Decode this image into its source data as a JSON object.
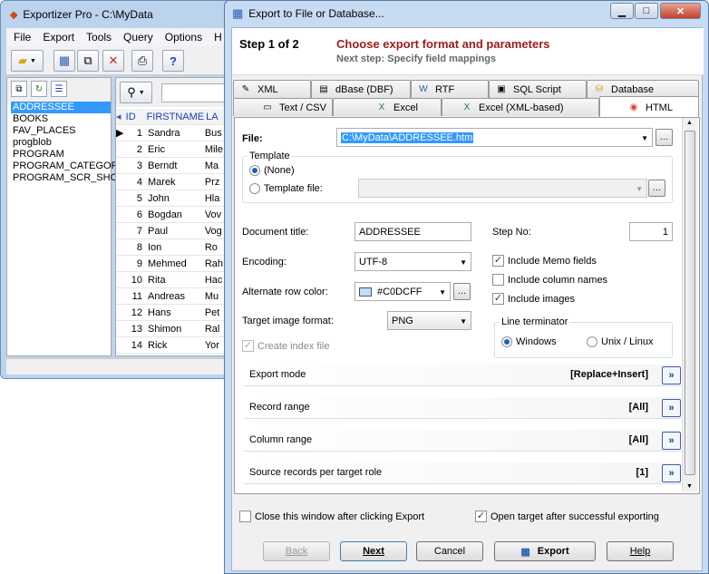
{
  "background_window": {
    "title": "Exportizer Pro - C:\\MyData",
    "menu": [
      "File",
      "Export",
      "Tools",
      "Query",
      "Options",
      "H"
    ],
    "tables": [
      "ADDRESSEE",
      "BOOKS",
      "FAV_PLACES",
      "progblob",
      "PROGRAM",
      "PROGRAM_CATEGOR'",
      "PROGRAM_SCR_SHOT"
    ],
    "grid_headers": [
      "ID",
      "FIRSTNAME",
      "LA"
    ],
    "rows": [
      [
        "1",
        "Sandra",
        "Bus"
      ],
      [
        "2",
        "Eric",
        "Mile"
      ],
      [
        "3",
        "Berndt",
        "Ma"
      ],
      [
        "4",
        "Marek",
        "Prz"
      ],
      [
        "5",
        "John",
        "Hla"
      ],
      [
        "6",
        "Bogdan",
        "Vov"
      ],
      [
        "7",
        "Paul",
        "Vog"
      ],
      [
        "8",
        "Ion",
        "Ro"
      ],
      [
        "9",
        "Mehmed",
        "Rah"
      ],
      [
        "10",
        "Rita",
        "Hac"
      ],
      [
        "11",
        "Andreas",
        "Mu"
      ],
      [
        "12",
        "Hans",
        "Pet"
      ],
      [
        "13",
        "Shimon",
        "Ral"
      ],
      [
        "14",
        "Rick",
        "Yor"
      ]
    ]
  },
  "dialog": {
    "title": "Export to File or Database...",
    "step": "Step 1 of 2",
    "step_desc": "Choose export format and parameters",
    "next_step": "Next step: Specify field mappings",
    "tabs_row1": [
      "XML",
      "dBase (DBF)",
      "RTF",
      "SQL Script",
      "Database"
    ],
    "tabs_row2": [
      "Text / CSV",
      "Excel",
      "Excel (XML-based)",
      "HTML"
    ],
    "file_label": "File:",
    "file_value": "C:\\MyData\\ADDRESSEE.htm",
    "template_group": "Template",
    "template_none": "(None)",
    "template_file": "Template file:",
    "doc_title_label": "Document title:",
    "doc_title_value": "ADDRESSEE",
    "step_no_label": "Step No:",
    "step_no_value": "1",
    "encoding_label": "Encoding:",
    "encoding_value": "UTF-8",
    "alt_color_label": "Alternate row color:",
    "alt_color_value": "#C0DCFF",
    "alt_color_swatch": "#C0DCFF",
    "img_format_label": "Target image format:",
    "img_format_value": "PNG",
    "create_index": "Create index file",
    "include_memo": "Include Memo fields",
    "include_colnames": "Include column names",
    "include_images": "Include images",
    "line_term": "Line terminator",
    "windows": "Windows",
    "unix": "Unix / Linux",
    "sections": [
      {
        "label": "Export mode",
        "value": "[Replace+Insert]"
      },
      {
        "label": "Record range",
        "value": "[All]"
      },
      {
        "label": "Column range",
        "value": "[All]"
      },
      {
        "label": "Source records per target role",
        "value": "[1]"
      }
    ],
    "close_after": "Close this window after clicking Export",
    "open_after": "Open target after successful exporting",
    "buttons": {
      "back": "Back",
      "next": "Next",
      "cancel": "Cancel",
      "export": "Export",
      "help": "Help"
    }
  }
}
